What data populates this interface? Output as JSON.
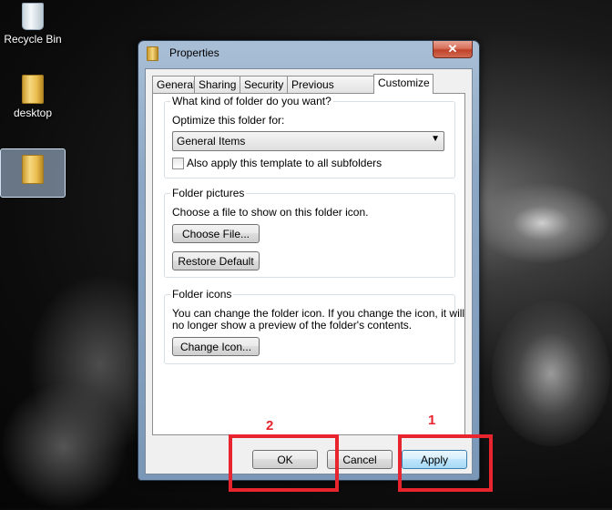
{
  "desktop": {
    "icons": [
      {
        "label": "Recycle Bin",
        "icon": "recycle-bin-icon"
      },
      {
        "label": "desktop",
        "icon": "folder-icon"
      },
      {
        "label": "",
        "icon": "folder-icon"
      }
    ]
  },
  "window": {
    "title": "Properties",
    "close_label": "✕",
    "tabs": [
      "General",
      "Sharing",
      "Security",
      "Previous Versions",
      "Customize"
    ],
    "active_tab": "Customize"
  },
  "customize": {
    "group1": {
      "title": "What kind of folder do you want?",
      "optimize_label": "Optimize this folder for:",
      "optimize_value": "General Items",
      "apply_subfolders_label": "Also apply this template to all subfolders",
      "apply_subfolders_checked": false
    },
    "group2": {
      "title": "Folder pictures",
      "desc": "Choose a file to show on this folder icon.",
      "choose_file": "Choose File...",
      "restore_default": "Restore Default"
    },
    "group3": {
      "title": "Folder icons",
      "desc_line1": "You can change the folder icon. If you change the icon, it will",
      "desc_line2": "no longer show a preview of the folder's contents.",
      "change_icon": "Change Icon..."
    }
  },
  "footer": {
    "ok": "OK",
    "cancel": "Cancel",
    "apply": "Apply"
  },
  "annotations": {
    "step1": "1",
    "step2": "2",
    "color": "#e8242e"
  }
}
